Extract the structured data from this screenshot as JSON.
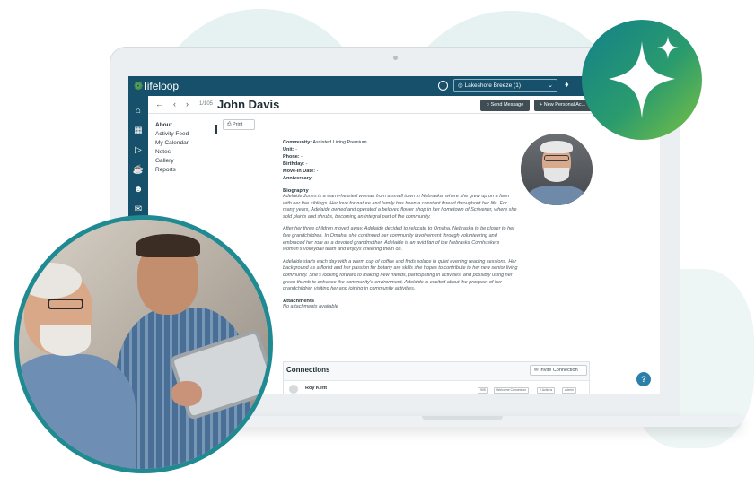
{
  "colors": {
    "primary": "#17506a",
    "accent": "#6cc04a",
    "button_dark": "#3f4e55",
    "help": "#2b7fa8",
    "badge_ring": "#1f8a92"
  },
  "app": {
    "logo_text": "lifeloop"
  },
  "topbar": {
    "location": "Lakeshore Breeze (1)",
    "info_icon": "info-icon",
    "bell_icon": "bell-icon"
  },
  "subbar": {
    "page_count": "1/105",
    "name": "John Davis",
    "send_message": "Send Message",
    "add_button": "New Personal Ac..."
  },
  "nav": {
    "items": [
      "About",
      "Activity Feed",
      "My Calendar",
      "Notes",
      "Gallery",
      "Reports"
    ],
    "active": "About"
  },
  "toolbar": {
    "print": "Print"
  },
  "profile": {
    "community_label": "Community:",
    "community_value": "Assisted Living Premium",
    "unit_label": "Unit:",
    "unit_value": "-",
    "phone_label": "Phone:",
    "phone_value": "-",
    "birthday_label": "Birthday:",
    "birthday_value": "-",
    "movein_label": "Move-In Date:",
    "movein_value": "-",
    "anniversary_label": "Anniversary:",
    "anniversary_value": "-"
  },
  "biography": {
    "title": "Biography",
    "paragraphs": [
      "Adelaide Jones is a warm-hearted woman from a small town in Nebraska, where she grew up on a farm with her five siblings. Her love for nature and family has been a constant thread throughout her life. For many years, Adelaide owned and operated a beloved flower shop in her hometown of Scrivener, where she sold plants and shrubs, becoming an integral part of the community.",
      "After her three children moved away, Adelaide decided to relocate to Omaha, Nebraska to be closer to her five grandchildren. In Omaha, she continued her community involvement through volunteering and embraced her role as a devoted grandmother. Adelaide is an avid fan of the Nebraska Cornhuskers women's volleyball team and enjoys cheering them on.",
      "Adelaide starts each day with a warm cup of coffee and finds solace in quiet evening reading sessions. Her background as a florist and her passion for botany are skills she hopes to contribute to her new senior living community. She's looking forward to making new friends, participating in activities, and possibly using her green thumb to enhance the community's environment. Adelaide is excited about the prospect of her grandchildren visiting her and joining in community activities."
    ]
  },
  "attachments": {
    "title": "Attachments",
    "empty_text": "No attachments available"
  },
  "connections": {
    "title": "Connections",
    "invite": "Invite Connection",
    "rows": [
      {
        "name": "Roy Kent",
        "tags": [
          "905",
          "Welcome Connection",
          "2 Actions",
          "Admin"
        ]
      }
    ]
  },
  "help": {
    "label": "?"
  }
}
